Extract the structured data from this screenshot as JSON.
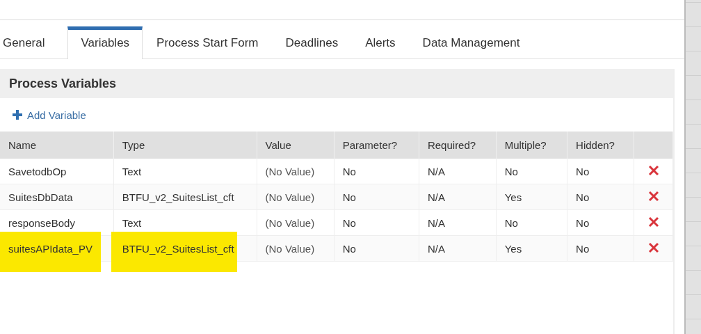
{
  "tabs": [
    {
      "label": "General",
      "selected": false
    },
    {
      "label": "Variables",
      "selected": true
    },
    {
      "label": "Process Start Form",
      "selected": false
    },
    {
      "label": "Deadlines",
      "selected": false
    },
    {
      "label": "Alerts",
      "selected": false
    },
    {
      "label": "Data Management",
      "selected": false
    }
  ],
  "panel": {
    "title": "Process Variables",
    "add_label": "Add Variable"
  },
  "table": {
    "columns": [
      "Name",
      "Type",
      "Value",
      "Parameter?",
      "Required?",
      "Multiple?",
      "Hidden?"
    ],
    "rows": [
      {
        "cells": [
          "SavetodbOp",
          "Text",
          "(No Value)",
          "No",
          "N/A",
          "No",
          "No"
        ],
        "highlighted": false
      },
      {
        "cells": [
          "SuitesDbData",
          "BTFU_v2_SuitesList_cft",
          "(No Value)",
          "No",
          "N/A",
          "Yes",
          "No"
        ],
        "highlighted": false
      },
      {
        "cells": [
          "responseBody",
          "Text",
          "(No Value)",
          "No",
          "N/A",
          "No",
          "No"
        ],
        "highlighted": false
      },
      {
        "cells": [
          "suitesAPIdata_PV",
          "BTFU_v2_SuitesList_cft",
          "(No Value)",
          "No",
          "N/A",
          "Yes",
          "No"
        ],
        "highlighted": true
      }
    ]
  }
}
